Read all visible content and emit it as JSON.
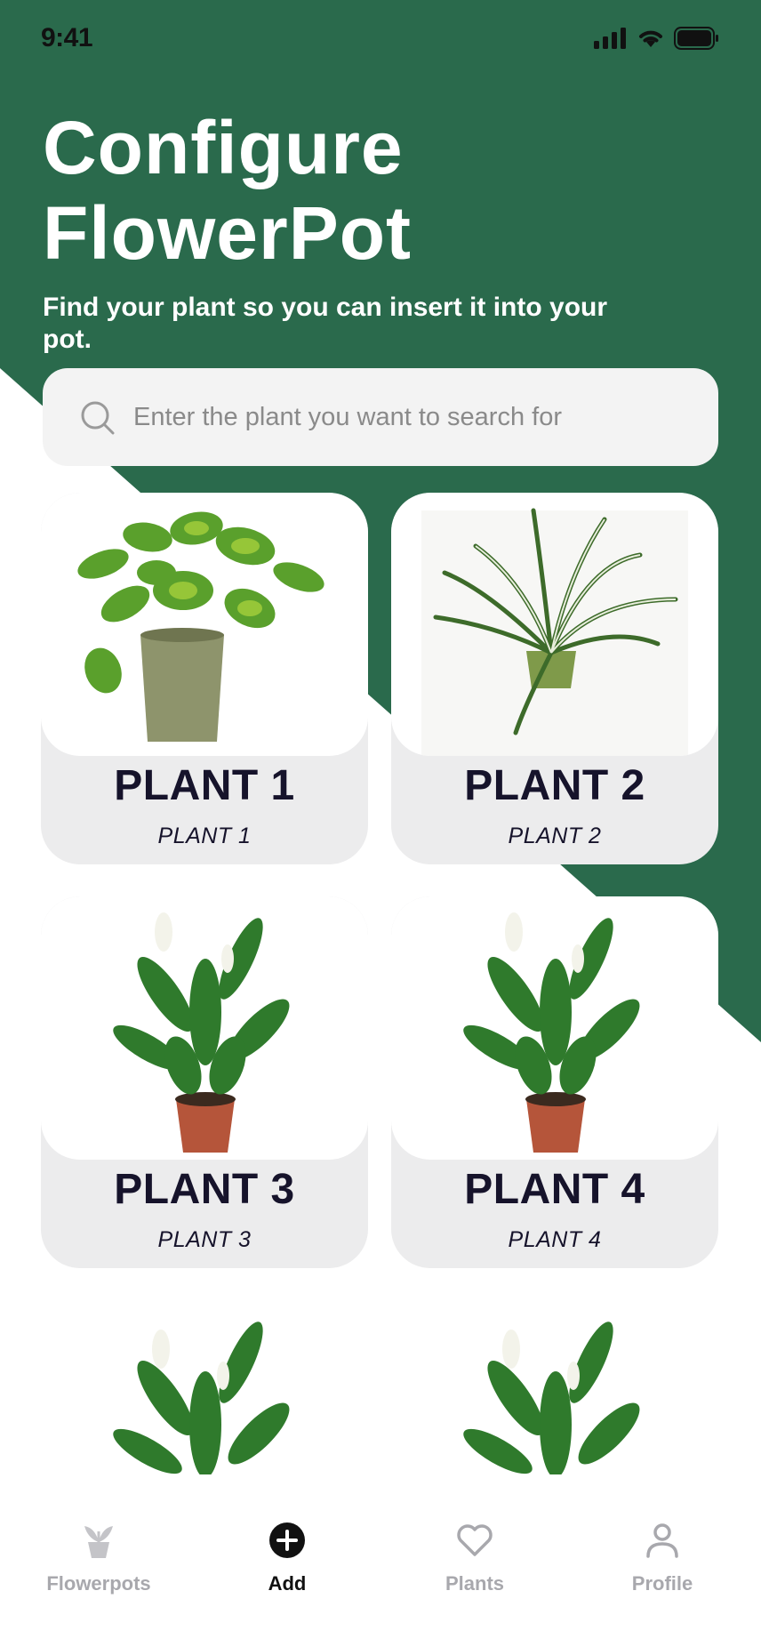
{
  "status_bar": {
    "time": "9:41"
  },
  "header": {
    "title": "Configure FlowerPot",
    "subtitle": "Find your plant so you can insert it into your pot."
  },
  "search": {
    "placeholder": "Enter the plant you want to search for",
    "value": ""
  },
  "plants": [
    {
      "name": "PLANT 1",
      "subtitle": "PLANT 1",
      "image": "pothos-plant"
    },
    {
      "name": "PLANT 2",
      "subtitle": "PLANT 2",
      "image": "spider-plant"
    },
    {
      "name": "PLANT 3",
      "subtitle": "PLANT 3",
      "image": "peace-lily"
    },
    {
      "name": "PLANT 4",
      "subtitle": "PLANT 4",
      "image": "peace-lily"
    },
    {
      "name": "",
      "subtitle": "",
      "image": "peace-lily"
    },
    {
      "name": "",
      "subtitle": "",
      "image": "peace-lily"
    }
  ],
  "nav": {
    "items": [
      {
        "label": "Flowerpots",
        "icon": "sprout-pot-icon",
        "active": false
      },
      {
        "label": "Add",
        "icon": "add-circle-icon",
        "active": true
      },
      {
        "label": "Plants",
        "icon": "heart-icon",
        "active": false
      },
      {
        "label": "Profile",
        "icon": "profile-icon",
        "active": false
      }
    ]
  },
  "colors": {
    "brand_green": "#2a6a4c",
    "card_gray": "#ececed",
    "text_dark": "#16132b",
    "nav_inactive": "#a8a8ad"
  }
}
